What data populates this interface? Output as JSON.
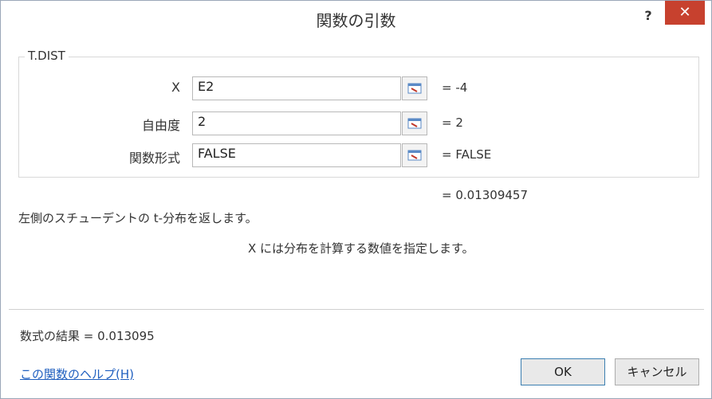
{
  "dialog": {
    "title": "関数の引数",
    "help_glyph": "?",
    "close_glyph": "✕"
  },
  "group": {
    "name": "T.DIST",
    "args": [
      {
        "label": "X",
        "value": "E2",
        "result": "= -4"
      },
      {
        "label": "自由度",
        "value": "2",
        "result": "= 2"
      },
      {
        "label": "関数形式",
        "value": "FALSE",
        "result": "= FALSE"
      }
    ]
  },
  "result_line": "= 0.01309457",
  "description": "左側のスチューデントの t-分布を返します。",
  "arg_description": "X  には分布を計算する数値を指定します。",
  "formula_result": "数式の結果 =   0.013095",
  "help_link": "この関数のヘルプ(H)",
  "buttons": {
    "ok": "OK",
    "cancel": "キャンセル"
  },
  "colors": {
    "close_button": "#c7412e",
    "link": "#1f5fbf"
  }
}
